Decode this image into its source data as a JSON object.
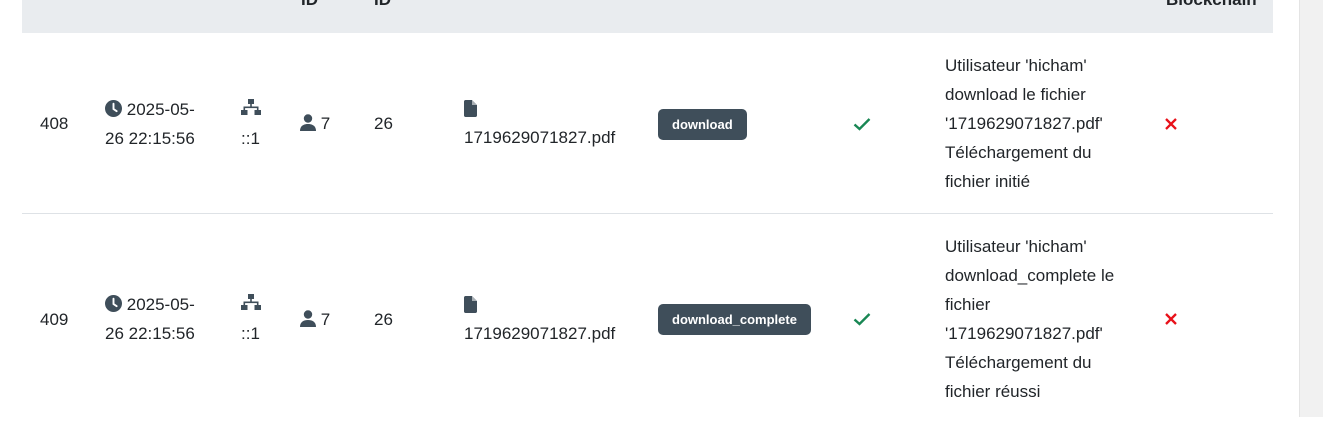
{
  "header": {
    "col_user_id": "ID",
    "col_file_id": "ID",
    "col_blockchain": "Blockchain"
  },
  "rows": [
    {
      "id": "408",
      "date_line1": "2025-05-",
      "date_line2": "26 22:15:56",
      "ip": "::1",
      "user_id": "7",
      "file_id": "26",
      "filename": "1719629071827.pdf",
      "action": "download",
      "details": [
        "Utilisateur 'hicham'",
        "download le fichier",
        "'1719629071827.pdf'",
        "Téléchargement du",
        "fichier initié"
      ]
    },
    {
      "id": "409",
      "date_line1": "2025-05-",
      "date_line2": "26 22:15:56",
      "ip": "::1",
      "user_id": "7",
      "file_id": "26",
      "filename": "1719629071827.pdf",
      "action": "download_complete",
      "details": [
        "Utilisateur 'hicham'",
        "download_complete le",
        "fichier",
        "'1719629071827.pdf'",
        "Téléchargement du",
        "fichier réussi"
      ]
    }
  ],
  "icons": {
    "clock": "clock-icon",
    "network": "network-icon",
    "user": "user-icon",
    "file": "file-icon",
    "success": "check-icon",
    "blockchain": "x-icon"
  },
  "colors": {
    "success": "#198754",
    "error": "#dc3545",
    "badge": "#3f4e5a",
    "header_bg": "#e9ecef"
  }
}
